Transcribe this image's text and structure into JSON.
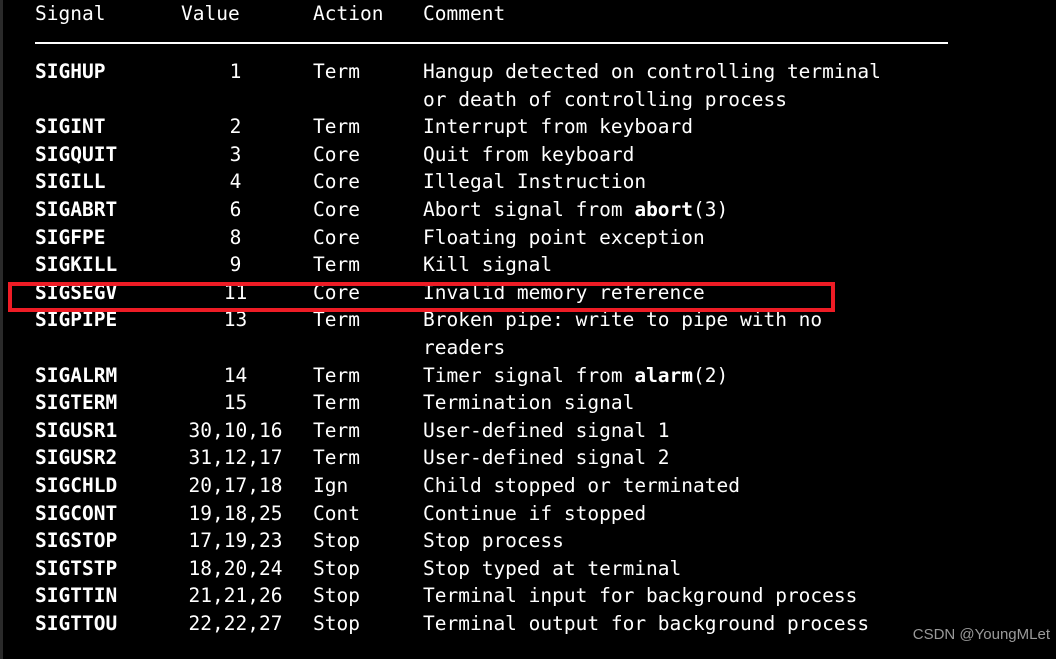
{
  "terminal": {
    "columns": {
      "signal": "Signal",
      "value": "Value",
      "action": "Action",
      "comment": "Comment"
    },
    "rows": [
      {
        "signal": "SIGHUP",
        "value": "1",
        "action": "Term",
        "comment": "Hangup detected on controlling terminal",
        "comment_cont": "or death of controlling process",
        "highlighted": false
      },
      {
        "signal": "SIGINT",
        "value": "2",
        "action": "Term",
        "comment": "Interrupt from keyboard",
        "highlighted": false
      },
      {
        "signal": "SIGQUIT",
        "value": "3",
        "action": "Core",
        "comment": "Quit from keyboard",
        "highlighted": false
      },
      {
        "signal": "SIGILL",
        "value": "4",
        "action": "Core",
        "comment": "Illegal Instruction",
        "highlighted": false
      },
      {
        "signal": "SIGABRT",
        "value": "6",
        "action": "Core",
        "comment_pre": "Abort signal from ",
        "comment_bold": "abort",
        "comment_post": "(3)",
        "highlighted": false
      },
      {
        "signal": "SIGFPE",
        "value": "8",
        "action": "Core",
        "comment": "Floating point exception",
        "highlighted": false
      },
      {
        "signal": "SIGKILL",
        "value": "9",
        "action": "Term",
        "comment": "Kill signal",
        "highlighted": false
      },
      {
        "signal": "SIGSEGV",
        "value": "11",
        "action": "Core",
        "comment": "Invalid memory reference",
        "highlighted": true
      },
      {
        "signal": "SIGPIPE",
        "value": "13",
        "action": "Term",
        "comment": "Broken pipe: write to pipe with no",
        "comment_cont": "readers",
        "highlighted": false
      },
      {
        "signal": "SIGALRM",
        "value": "14",
        "action": "Term",
        "comment_pre": "Timer signal from ",
        "comment_bold": "alarm",
        "comment_post": "(2)",
        "highlighted": false
      },
      {
        "signal": "SIGTERM",
        "value": "15",
        "action": "Term",
        "comment": "Termination signal",
        "highlighted": false
      },
      {
        "signal": "SIGUSR1",
        "value": "30,10,16",
        "action": "Term",
        "comment": "User-defined signal 1",
        "highlighted": false
      },
      {
        "signal": "SIGUSR2",
        "value": "31,12,17",
        "action": "Term",
        "comment": "User-defined signal 2",
        "highlighted": false
      },
      {
        "signal": "SIGCHLD",
        "value": "20,17,18",
        "action": "Ign",
        "comment": "Child stopped or terminated",
        "highlighted": false
      },
      {
        "signal": "SIGCONT",
        "value": "19,18,25",
        "action": "Cont",
        "comment": "Continue if stopped",
        "highlighted": false
      },
      {
        "signal": "SIGSTOP",
        "value": "17,19,23",
        "action": "Stop",
        "comment": "Stop process",
        "highlighted": false
      },
      {
        "signal": "SIGTSTP",
        "value": "18,20,24",
        "action": "Stop",
        "comment": "Stop typed at terminal",
        "highlighted": false
      },
      {
        "signal": "SIGTTIN",
        "value": "21,21,26",
        "action": "Stop",
        "comment": "Terminal input for background process",
        "highlighted": false
      },
      {
        "signal": "SIGTTOU",
        "value": "22,22,27",
        "action": "Stop",
        "comment": "Terminal output for background process",
        "highlighted": false
      }
    ]
  },
  "annotation": {
    "highlight_color": "#ee1c25",
    "highlighted_signal": "SIGSEGV"
  },
  "watermark": {
    "text": "CSDN @YoungMLet"
  }
}
